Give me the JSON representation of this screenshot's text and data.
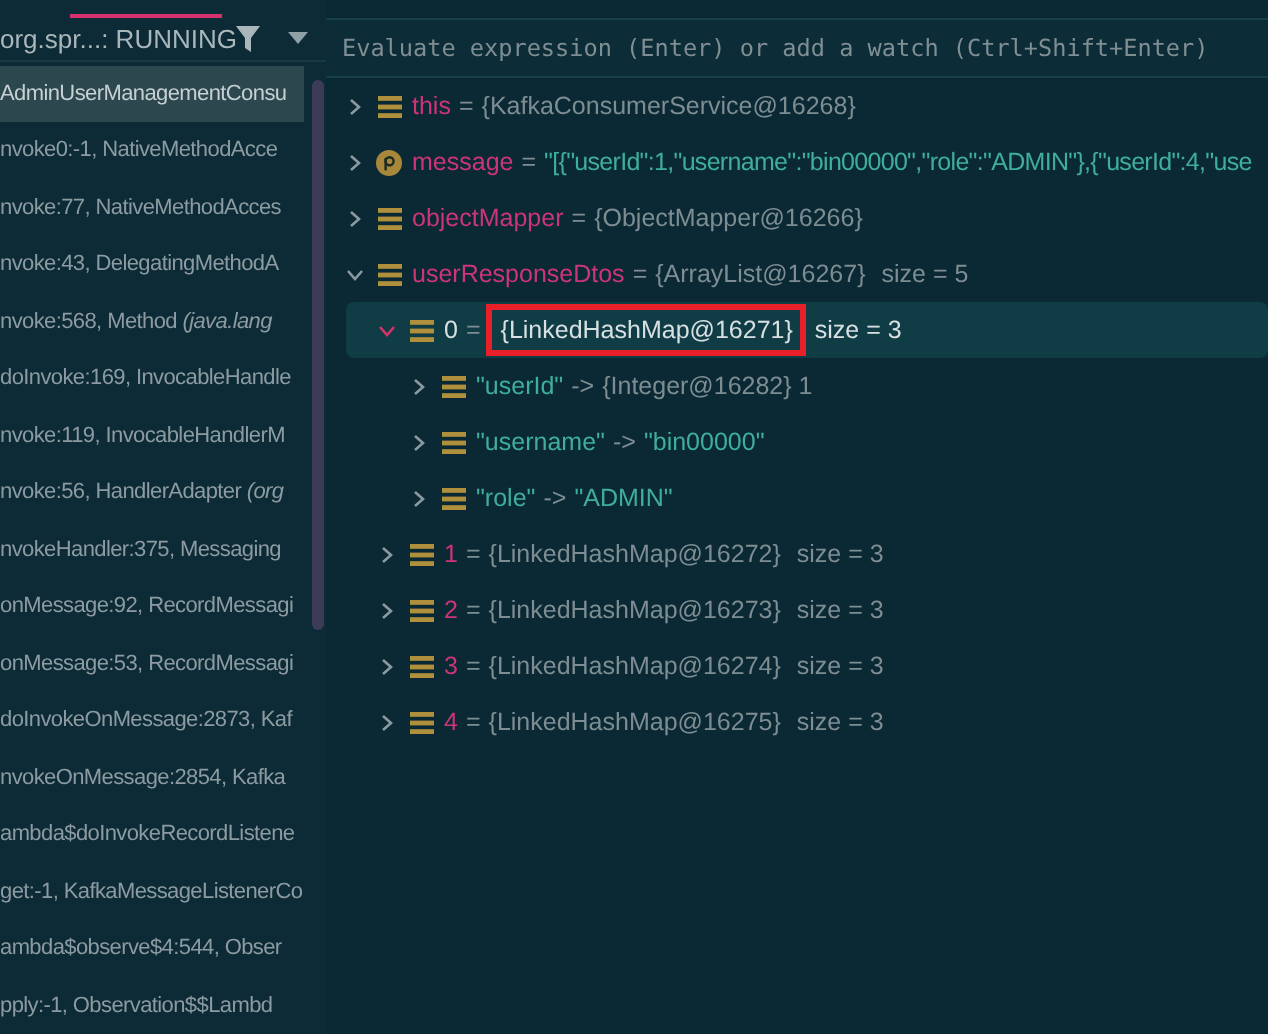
{
  "frames_panel": {
    "thread": "org.spr...: RUNNING",
    "frames": [
      {
        "text": "AdminUserManagementConsu",
        "selected": true
      },
      {
        "text": "nvoke0:-1, NativeMethodAcce",
        "selected": false
      },
      {
        "text": "nvoke:77, NativeMethodAcces",
        "selected": false
      },
      {
        "text": "nvoke:43, DelegatingMethodA",
        "selected": false
      },
      {
        "text": "nvoke:568, Method *(java.lang*",
        "selected": false
      },
      {
        "text": "doInvoke:169, InvocableHandle",
        "selected": false
      },
      {
        "text": "nvoke:119, InvocableHandlerM",
        "selected": false
      },
      {
        "text": "nvoke:56, HandlerAdapter *(org*",
        "selected": false
      },
      {
        "text": "nvokeHandler:375, Messaging",
        "selected": false
      },
      {
        "text": "onMessage:92, RecordMessagi",
        "selected": false
      },
      {
        "text": "onMessage:53, RecordMessagi",
        "selected": false
      },
      {
        "text": "doInvokeOnMessage:2873, Kaf",
        "selected": false
      },
      {
        "text": "nvokeOnMessage:2854, Kafka",
        "selected": false
      },
      {
        "text": "ambda$doInvokeRecordListene",
        "selected": false
      },
      {
        "text": "get:-1, KafkaMessageListenerCo",
        "selected": false
      },
      {
        "text": "ambda$observe$4:544, Obser",
        "selected": false
      },
      {
        "text": "pply:-1, Observation$$Lambd",
        "selected": false
      }
    ]
  },
  "variables_panel": {
    "evaluate_field": {
      "placeholder": "Evaluate expression (Enter) or add a watch (Ctrl+Shift+Enter)"
    },
    "variables": [
      {
        "kind": "field",
        "name": "this",
        "separator": "=",
        "value": "{KafkaConsumerService@16268}",
        "string_value": false,
        "expanded": false,
        "selected": false
      },
      {
        "kind": "param",
        "name": "message",
        "separator": "=",
        "value": "\"[{\"userId\":1,\"username\":\"bin00000\",\"role\":\"ADMIN\"},{\"userId\":4,\"use",
        "string_value": true,
        "expanded": false,
        "selected": false
      },
      {
        "kind": "field",
        "name": "objectMapper",
        "separator": "=",
        "value": "{ObjectMapper@16266}",
        "string_value": false,
        "expanded": false,
        "selected": false
      },
      {
        "kind": "field",
        "name": "userResponseDtos",
        "separator": "=",
        "value": "{ArrayList@16267}",
        "string_value": false,
        "size": "size = 5",
        "expanded": true,
        "selected": false,
        "children": [
          {
            "kind": "field",
            "name": "0",
            "separator": "=",
            "value": "{LinkedHashMap@16271}",
            "string_value": false,
            "size": "size = 3",
            "expanded": true,
            "selected": true,
            "highlighted": true,
            "children": [
              {
                "kind": "entry",
                "name": "\"userId\"",
                "separator": "->",
                "value": "{Integer@16282} 1",
                "string_value": false,
                "expanded": false,
                "selected": false
              },
              {
                "kind": "entry",
                "name": "\"username\"",
                "separator": "->",
                "value": "\"bin00000\"",
                "string_value": true,
                "expanded": false,
                "selected": false
              },
              {
                "kind": "entry",
                "name": "\"role\"",
                "separator": "->",
                "value": "\"ADMIN\"",
                "string_value": true,
                "expanded": false,
                "selected": false
              }
            ]
          },
          {
            "kind": "field",
            "name": "1",
            "separator": "=",
            "value": "{LinkedHashMap@16272}",
            "string_value": false,
            "size": "size = 3",
            "expanded": false,
            "selected": false
          },
          {
            "kind": "field",
            "name": "2",
            "separator": "=",
            "value": "{LinkedHashMap@16273}",
            "string_value": false,
            "size": "size = 3",
            "expanded": false,
            "selected": false
          },
          {
            "kind": "field",
            "name": "3",
            "separator": "=",
            "value": "{LinkedHashMap@16274}",
            "string_value": false,
            "size": "size = 3",
            "expanded": false,
            "selected": false
          },
          {
            "kind": "field",
            "name": "4",
            "separator": "=",
            "value": "{LinkedHashMap@16275}",
            "string_value": false,
            "size": "size = 3",
            "expanded": false,
            "selected": false
          }
        ]
      }
    ]
  }
}
